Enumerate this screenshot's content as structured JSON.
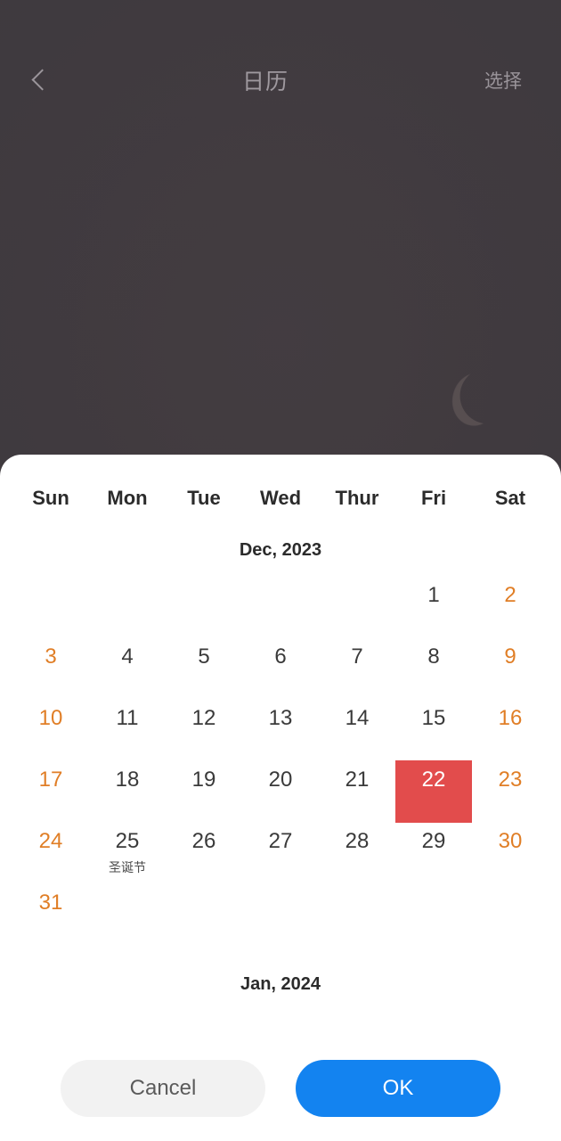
{
  "navbar": {
    "back_icon": "chevron-left-icon",
    "title": "日历",
    "action_label": "选择"
  },
  "calendar": {
    "weekdays": [
      "Sun",
      "Mon",
      "Tue",
      "Wed",
      "Thur",
      "Fri",
      "Sat"
    ],
    "selected_date": 22,
    "selected_color": "#e24c4c",
    "weekend_color": "#e07e26",
    "months": [
      {
        "title": "Dec, 2023",
        "lead_blanks": 5,
        "days": [
          {
            "n": 1,
            "weekend": false
          },
          {
            "n": 2,
            "weekend": true
          },
          {
            "n": 3,
            "weekend": true
          },
          {
            "n": 4,
            "weekend": false
          },
          {
            "n": 5,
            "weekend": false
          },
          {
            "n": 6,
            "weekend": false
          },
          {
            "n": 7,
            "weekend": false
          },
          {
            "n": 8,
            "weekend": false
          },
          {
            "n": 9,
            "weekend": true
          },
          {
            "n": 10,
            "weekend": true
          },
          {
            "n": 11,
            "weekend": false
          },
          {
            "n": 12,
            "weekend": false
          },
          {
            "n": 13,
            "weekend": false
          },
          {
            "n": 14,
            "weekend": false
          },
          {
            "n": 15,
            "weekend": false
          },
          {
            "n": 16,
            "weekend": true
          },
          {
            "n": 17,
            "weekend": true
          },
          {
            "n": 18,
            "weekend": false
          },
          {
            "n": 19,
            "weekend": false
          },
          {
            "n": 20,
            "weekend": false
          },
          {
            "n": 21,
            "weekend": false
          },
          {
            "n": 22,
            "weekend": false,
            "selected": true
          },
          {
            "n": 23,
            "weekend": true
          },
          {
            "n": 24,
            "weekend": true
          },
          {
            "n": 25,
            "weekend": false,
            "festival": "圣诞节"
          },
          {
            "n": 26,
            "weekend": false
          },
          {
            "n": 27,
            "weekend": false
          },
          {
            "n": 28,
            "weekend": false
          },
          {
            "n": 29,
            "weekend": false
          },
          {
            "n": 30,
            "weekend": true
          },
          {
            "n": 31,
            "weekend": true
          }
        ]
      },
      {
        "title": "Jan, 2024",
        "lead_blanks": 1,
        "days": []
      }
    ]
  },
  "footer": {
    "cancel_label": "Cancel",
    "ok_label": "OK",
    "ok_color": "#1383f0",
    "cancel_color": "#f2f2f2"
  }
}
